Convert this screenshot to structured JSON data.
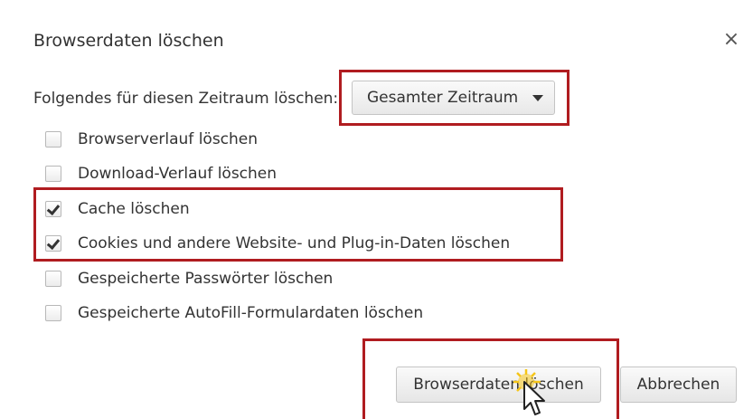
{
  "dialog": {
    "title": "Browserdaten löschen",
    "close_glyph": "×"
  },
  "time_range": {
    "label": "Folgendes für diesen Zeitraum löschen:",
    "selected": "Gesamter Zeitraum"
  },
  "options": [
    {
      "label": "Browserverlauf löschen",
      "checked": false
    },
    {
      "label": "Download-Verlauf löschen",
      "checked": false
    },
    {
      "label": "Cache löschen",
      "checked": true
    },
    {
      "label": "Cookies und andere Website- und Plug-in-Daten löschen",
      "checked": true
    },
    {
      "label": "Gespeicherte Passwörter löschen",
      "checked": false
    },
    {
      "label": "Gespeicherte AutoFill-Formulardaten löschen",
      "checked": false
    }
  ],
  "buttons": {
    "clear": "Browserdaten löschen",
    "cancel": "Abbrechen"
  },
  "colors": {
    "highlight": "#b01c20",
    "cursor_glow": "#f5c518"
  },
  "icons": {
    "close": "close-icon",
    "dropdown": "caret-down-icon",
    "pointer": "pointer-cursor-icon"
  }
}
